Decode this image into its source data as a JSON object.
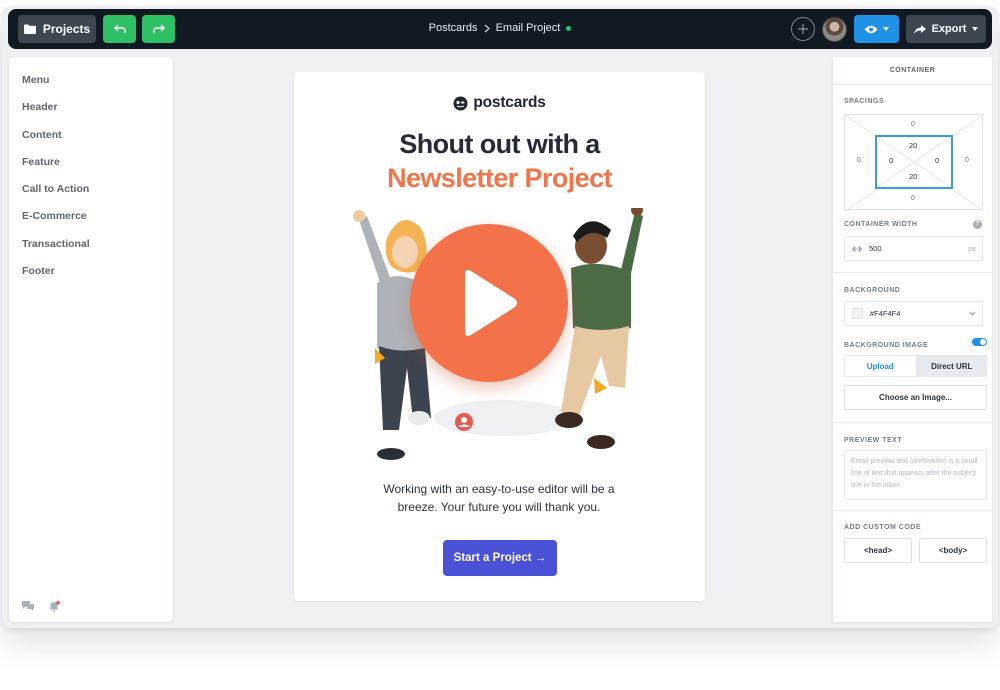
{
  "topbar": {
    "projects_label": "Projects",
    "breadcrumb_root": "Postcards",
    "breadcrumb_current": "Email Project",
    "export_label": "Export"
  },
  "sidebar": {
    "items": [
      {
        "label": "Menu"
      },
      {
        "label": "Header"
      },
      {
        "label": "Content"
      },
      {
        "label": "Feature"
      },
      {
        "label": "Call to Action"
      },
      {
        "label": "E-Commerce"
      },
      {
        "label": "Transactional"
      },
      {
        "label": "Footer"
      }
    ]
  },
  "canvas": {
    "logo_text": "postcards",
    "headline_line1": "Shout out with a",
    "headline_line2": "Newsletter Project",
    "body_line1": "Working with an easy-to-use editor will be a",
    "body_line2": "breeze. Your future you will thank you.",
    "cta_label": "Start a Project →"
  },
  "panel": {
    "title": "CONTAINER",
    "spacings_label": "SPACINGS",
    "margin": {
      "top": "0",
      "right": "0",
      "bottom": "0",
      "left": "0"
    },
    "padding": {
      "top": "20",
      "right": "0",
      "bottom": "20",
      "left": "0"
    },
    "container_width_label": "CONTAINER WIDTH",
    "container_width_value": "500",
    "container_width_unit": "px",
    "background_label": "BACKGROUND",
    "background_value": "#F4F4F4",
    "background_image_label": "BACKGROUND IMAGE",
    "tab_upload": "Upload",
    "tab_direct_url": "Direct URL",
    "choose_image_label": "Choose an Image...",
    "preview_text_label": "PREVIEW TEXT",
    "preview_text_placeholder": "Email preview text (preheader) is a small line of text that appears after the subject line in the inbox.",
    "custom_code_label": "ADD CUSTOM CODE",
    "head_button": "<head>",
    "body_button": "<body>"
  },
  "colors": {
    "topbar_bg": "#111a22",
    "accent_blue": "#1f92e8",
    "accent_green": "#2fc066",
    "headline_orange": "#f37448",
    "cta_purple": "#4a51d6"
  },
  "icons": [
    "folder-icon",
    "undo-icon",
    "redo-icon",
    "chevron-right-icon",
    "plus-icon",
    "eye-icon",
    "share-icon",
    "caret-down-icon",
    "chat-icon",
    "bell-icon",
    "play-icon",
    "width-arrows-icon",
    "help-icon"
  ]
}
